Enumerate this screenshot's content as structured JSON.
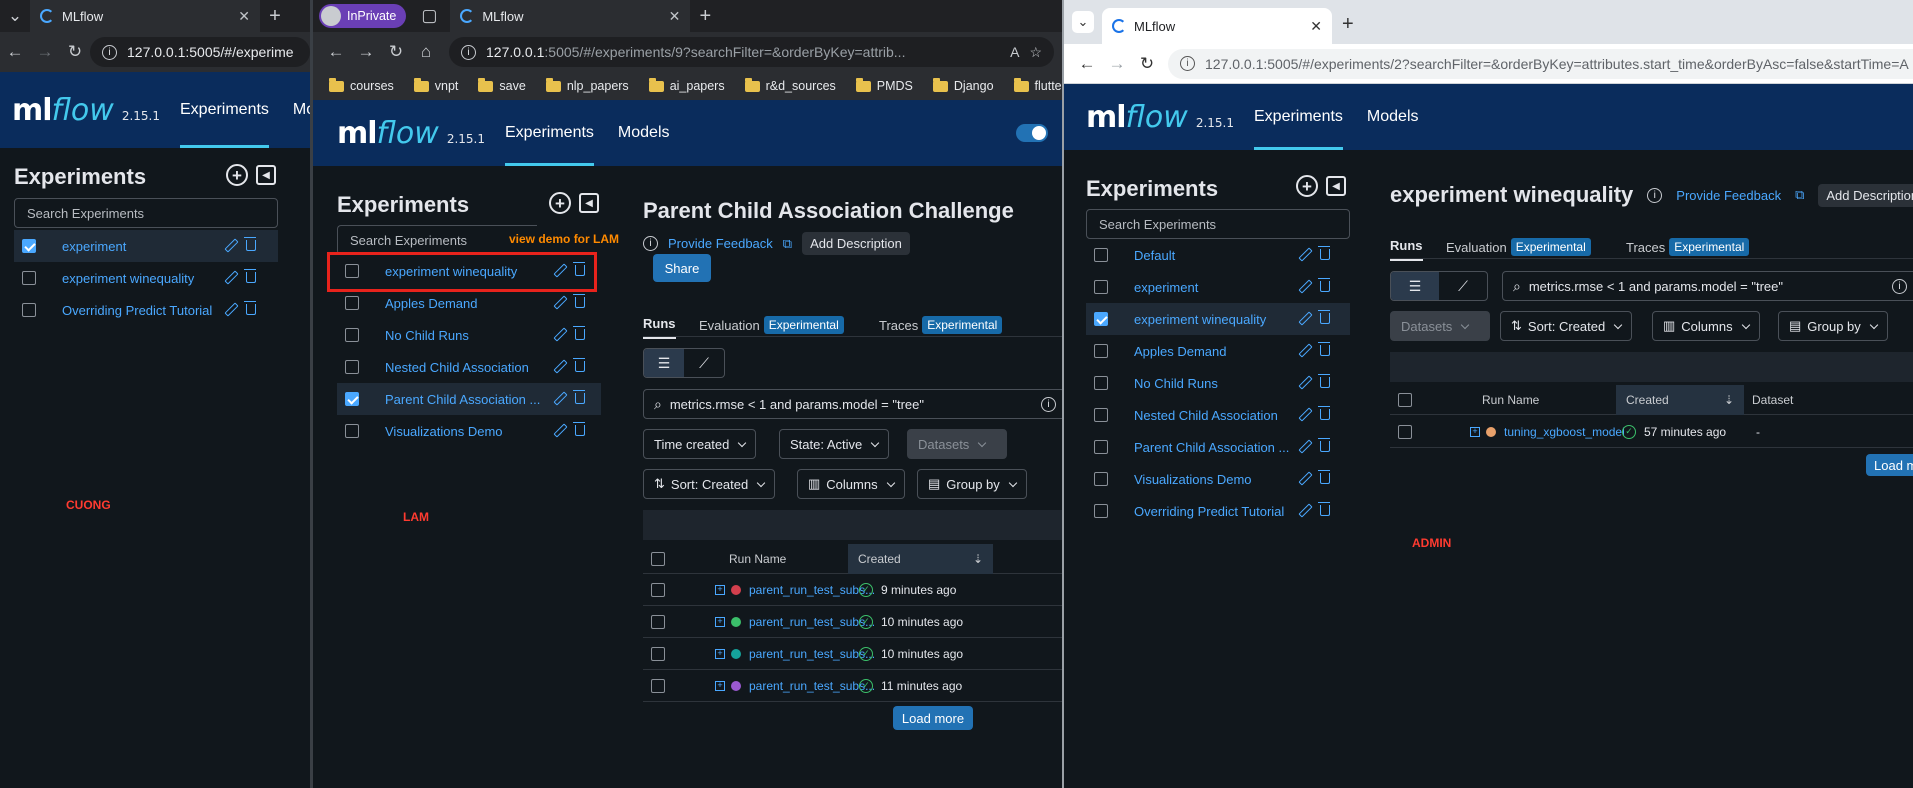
{
  "window1": {
    "tab_title": "MLflow",
    "url": "127.0.0.1:5005/#/experime",
    "brand": {
      "ml": "ml",
      "flow": "flow",
      "version": "2.15.1"
    },
    "nav": {
      "experiments": "Experiments",
      "models": "Mo"
    },
    "sidebar_title": "Experiments",
    "search_placeholder": "Search Experiments",
    "experiments": [
      {
        "name": "experiment",
        "selected": true
      },
      {
        "name": "experiment winequality",
        "selected": false
      },
      {
        "name": "Overriding Predict Tutorial",
        "selected": false
      }
    ],
    "user_label": "CUONG"
  },
  "window2": {
    "inprivate_label": "InPrivate",
    "tab_title": "MLflow",
    "url_host": "127.0.0.1",
    "url_rest": ":5005/#/experiments/9?searchFilter=&orderByKey=attrib...",
    "bookmarks": [
      "courses",
      "vnpt",
      "save",
      "nlp_papers",
      "ai_papers",
      "r&d_sources",
      "PMDS",
      "Django",
      "flutter"
    ],
    "brand": {
      "ml": "ml",
      "flow": "flow",
      "version": "2.15.1"
    },
    "nav": {
      "experiments": "Experiments",
      "models": "Models"
    },
    "sidebar_title": "Experiments",
    "search_placeholder": "Search Experiments",
    "annotation": "view demo for LAM",
    "experiments": [
      {
        "name": "experiment winequality",
        "selected": false
      },
      {
        "name": "Apples Demand",
        "selected": false
      },
      {
        "name": "No Child Runs",
        "selected": false
      },
      {
        "name": "Nested Child Association",
        "selected": false
      },
      {
        "name": "Parent Child Association ...",
        "selected": true
      },
      {
        "name": "Visualizations Demo",
        "selected": false
      }
    ],
    "user_label": "LAM",
    "main": {
      "title": "Parent Child Association Challenge",
      "provide_feedback": "Provide Feedback",
      "add_description": "Add Description",
      "share": "Share",
      "tabs": {
        "runs": "Runs",
        "evaluation": "Evaluation",
        "traces": "Traces",
        "experimental": "Experimental"
      },
      "filter_query": "metrics.rmse < 1 and params.model = \"tree\"",
      "time_created": "Time created",
      "state": "State: Active",
      "datasets": "Datasets",
      "sort": "Sort: Created",
      "columns": "Columns",
      "group_by": "Group by",
      "col_run_name": "Run Name",
      "col_created": "Created",
      "runs": [
        {
          "name": "parent_run_test_subs...",
          "color": "#d33f4d",
          "created": "9 minutes ago"
        },
        {
          "name": "parent_run_test_subs...",
          "color": "#3bbf6a",
          "created": "10 minutes ago"
        },
        {
          "name": "parent_run_test_subs...",
          "color": "#15a39b",
          "created": "10 minutes ago"
        },
        {
          "name": "parent_run_test_subs...",
          "color": "#9b59d0",
          "created": "11 minutes ago"
        }
      ],
      "load_more": "Load more"
    }
  },
  "window3": {
    "tab_title": "MLflow",
    "url": "127.0.0.1:5005/#/experiments/2?searchFilter=&orderByKey=attributes.start_time&orderByAsc=false&startTime=A",
    "brand": {
      "ml": "ml",
      "flow": "flow",
      "version": "2.15.1"
    },
    "nav": {
      "experiments": "Experiments",
      "models": "Models"
    },
    "sidebar_title": "Experiments",
    "search_placeholder": "Search Experiments",
    "experiments": [
      {
        "name": "Default",
        "selected": false
      },
      {
        "name": "experiment",
        "selected": false
      },
      {
        "name": "experiment winequality",
        "selected": true
      },
      {
        "name": "Apples Demand",
        "selected": false
      },
      {
        "name": "No Child Runs",
        "selected": false
      },
      {
        "name": "Nested Child Association",
        "selected": false
      },
      {
        "name": "Parent Child Association ...",
        "selected": false
      },
      {
        "name": "Visualizations Demo",
        "selected": false
      },
      {
        "name": "Overriding Predict Tutorial",
        "selected": false
      }
    ],
    "user_label": "ADMIN",
    "main": {
      "title": "experiment winequality",
      "provide_feedback": "Provide Feedback",
      "add_description": "Add Description",
      "tabs": {
        "runs": "Runs",
        "evaluation": "Evaluation",
        "traces": "Traces",
        "experimental": "Experimental"
      },
      "filter_query": "metrics.rmse < 1 and params.model = \"tree\"",
      "datasets": "Datasets",
      "sort": "Sort: Created",
      "columns": "Columns",
      "group_by": "Group by",
      "col_run_name": "Run Name",
      "col_created": "Created",
      "col_dataset": "Dataset",
      "runs": [
        {
          "name": "tuning_xgboost_model",
          "color": "#e8a06a",
          "created": "57 minutes ago",
          "dataset": "-"
        }
      ],
      "load_more": "Load m"
    }
  }
}
